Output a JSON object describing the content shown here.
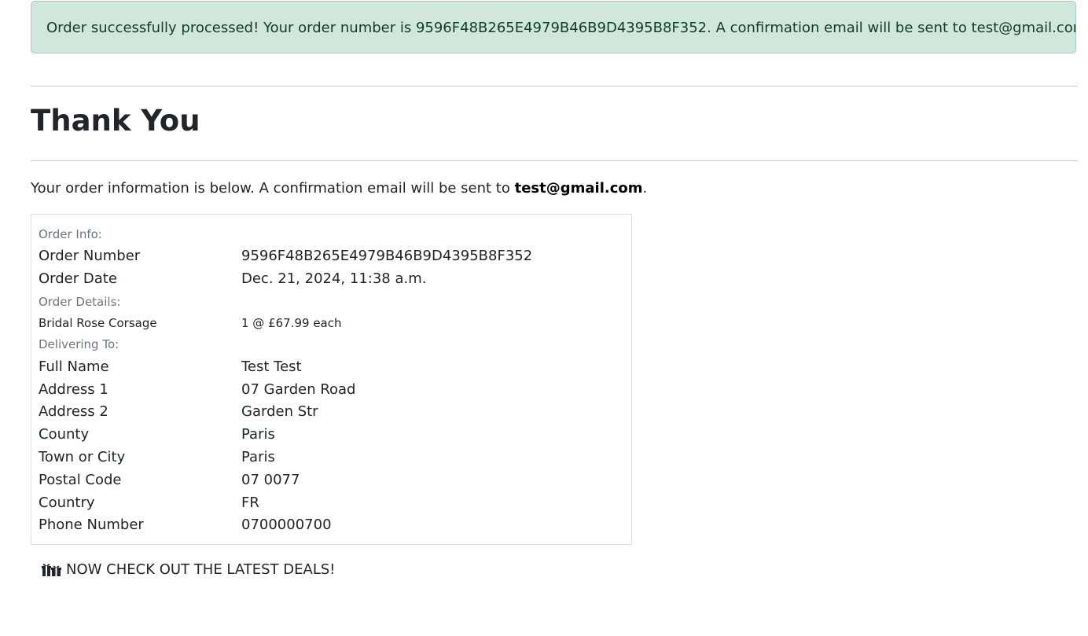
{
  "alert": {
    "message": "Order successfully processed! Your order number is 9596F48B265E4979B46B9D4395B8F352. A confirmation email will be sent to test@gmail.com."
  },
  "page": {
    "title": "Thank You",
    "intro_prefix": "Your order information is below. A confirmation email will be sent to ",
    "intro_email": "test@gmail.com",
    "intro_suffix": "."
  },
  "order_info": {
    "heading": "Order Info:",
    "number_label": "Order Number",
    "number_value": "9596F48B265E4979B46B9D4395B8F352",
    "date_label": "Order Date",
    "date_value": "Dec. 21, 2024, 11:38 a.m."
  },
  "order_details": {
    "heading": "Order Details:",
    "items": [
      {
        "name": "Bridal Rose Corsage",
        "qty_price": "1 @ £67.99 each"
      }
    ]
  },
  "delivery": {
    "heading": "Delivering To:",
    "fields": [
      {
        "label": "Full Name",
        "value": "Test Test"
      },
      {
        "label": "Address 1",
        "value": "07 Garden Road"
      },
      {
        "label": "Address 2",
        "value": "Garden Str"
      },
      {
        "label": "County",
        "value": "Paris"
      },
      {
        "label": "Town or City",
        "value": "Paris"
      },
      {
        "label": "Postal Code",
        "value": "07 0077"
      },
      {
        "label": "Country",
        "value": "FR"
      },
      {
        "label": "Phone Number",
        "value": "0700000700"
      }
    ]
  },
  "deals_link": {
    "label": "NOW CHECK OUT THE LATEST DEALS!",
    "icon": "gifts-icon"
  }
}
